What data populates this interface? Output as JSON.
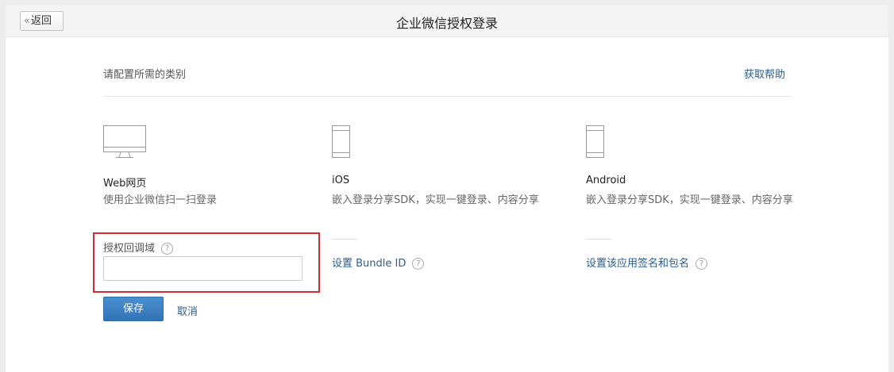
{
  "header": {
    "back_label": "返回",
    "title": "企业微信授权登录"
  },
  "main": {
    "subtitle": "请配置所需的类别",
    "help_link": "获取帮助",
    "options": [
      {
        "icon": "monitor-icon",
        "title": "Web网页",
        "desc": "使用企业微信扫一扫登录"
      },
      {
        "icon": "phone-icon",
        "title": "iOS",
        "desc": "嵌入登录分享SDK，实现一键登录、内容分享",
        "setting": "设置 Bundle ID"
      },
      {
        "icon": "phone-icon",
        "title": "Android",
        "desc": "嵌入登录分享SDK，实现一键登录、内容分享",
        "setting": "设置该应用签名和包名"
      }
    ],
    "form": {
      "label": "授权回调域",
      "value": "",
      "placeholder": "",
      "save_label": "保存",
      "cancel_label": "取消"
    }
  },
  "colors": {
    "accent": "#3a80c4",
    "link": "#2b5d8e",
    "highlight": "#d9282f"
  }
}
